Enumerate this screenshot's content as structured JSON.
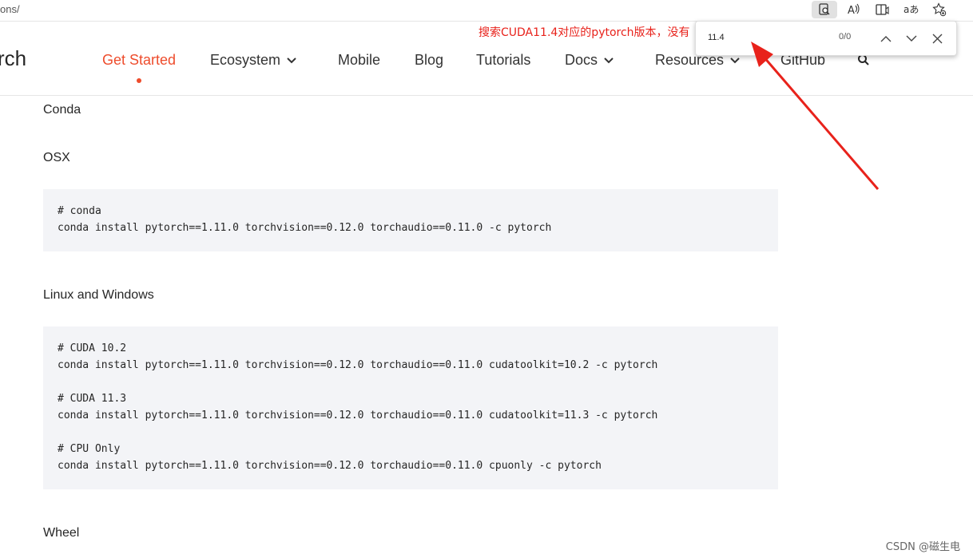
{
  "browser": {
    "url_fragment": "ons/",
    "toolbar": [
      "find-icon",
      "read-aloud-icon",
      "immersive-reader-icon",
      "translate-icon",
      "favorites-add-icon"
    ]
  },
  "header": {
    "logo": "rch",
    "nav": [
      {
        "label": "Get Started",
        "active": true
      },
      {
        "label": "Ecosystem",
        "dropdown": true
      },
      {
        "label": "Mobile"
      },
      {
        "label": "Blog"
      },
      {
        "label": "Tutorials"
      },
      {
        "label": "Docs",
        "dropdown": true
      },
      {
        "label": "Resources",
        "dropdown": true
      },
      {
        "label": "GitHub"
      }
    ],
    "accent_color": "#ee4c2c"
  },
  "find_bar": {
    "query": "11.4",
    "count": "0/0"
  },
  "annotation": {
    "text": "搜索CUDA11.4对应的pytorch版本，没有",
    "color": "#e8221b"
  },
  "content": {
    "conda_heading": "Conda",
    "osx_heading": "OSX",
    "osx_code": [
      "# conda",
      "conda install pytorch==1.11.0 torchvision==0.12.0 torchaudio==0.11.0 -c pytorch"
    ],
    "linux_heading": "Linux and Windows",
    "linux_code": [
      "# CUDA 10.2",
      "conda install pytorch==1.11.0 torchvision==0.12.0 torchaudio==0.11.0 cudatoolkit=10.2 -c pytorch",
      "",
      "# CUDA 11.3",
      "conda install pytorch==1.11.0 torchvision==0.12.0 torchaudio==0.11.0 cudatoolkit=11.3 -c pytorch",
      "",
      "# CPU Only",
      "conda install pytorch==1.11.0 torchvision==0.12.0 torchaudio==0.11.0 cpuonly -c pytorch"
    ],
    "wheel_heading": "Wheel"
  },
  "watermark": "CSDN @磁生电"
}
